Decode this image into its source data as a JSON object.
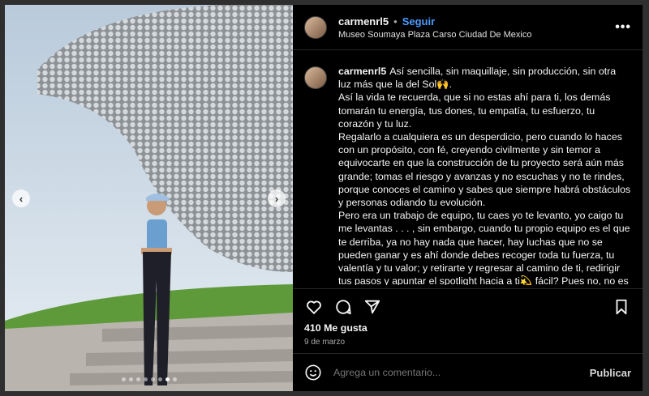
{
  "post": {
    "username": "carmenrl5",
    "separator": "•",
    "follow_label": "Seguir",
    "location": "Museo Soumaya Plaza Carso Ciudad De Mexico",
    "more_label": "•••"
  },
  "caption": {
    "username": "carmenrl5",
    "paragraphs": [
      "Así sencilla, sin maquillaje, sin producción, sin otra luz más que la del Sol🙌.",
      "Así la vida te recuerda, que si no estas ahí para ti, los demás tomarán tu energía, tus dones, tu empatía, tu esfuerzo, tu corazón y tu luz.",
      "Regalarlo a cualquiera es un desperdicio, pero cuando lo haces con un propósito, con fé, creyendo civilmente y sin temor a equivocarte en que la construcción de tu proyecto será aún más grande; tomas el riesgo y avanzas y no escuchas y no te rindes, porque conoces el camino y sabes que siempre habrá obstáculos y personas odiando tu evolución.",
      "Pero era un trabajo de equipo, tu caes yo te levanto, yo caigo tu me levantas . . . , sin embargo, cuando tu propio equipo es el que te derriba, ya no hay nada que hacer, hay luchas que no se pueden ganar y es ahí donde debes recoger toda tu fuerza, tu valentía y tu valor; y retirarte y regresar al camino de ti, redirigir tus pasos y apuntar el spotlight hacia a ti💫 fácil? Pues no, no es"
    ]
  },
  "stats": {
    "likes": "410 Me gusta",
    "date": "9 de marzo"
  },
  "comment": {
    "placeholder": "Agrega un comentario...",
    "publish_label": "Publicar"
  },
  "carousel": {
    "prev_icon": "chevron-left-icon",
    "next_icon": "chevron-right-icon",
    "slide_count": 8,
    "active_index": 6
  },
  "icons": {
    "like": "heart-icon",
    "comment": "comment-icon",
    "share": "share-icon",
    "save": "bookmark-icon",
    "emoji": "emoji-icon"
  }
}
